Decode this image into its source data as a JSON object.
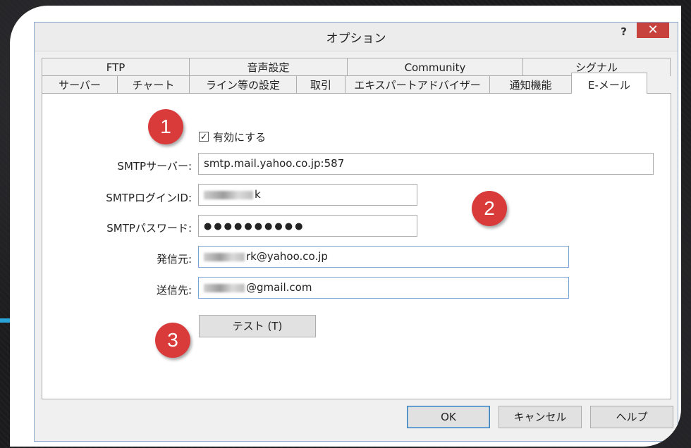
{
  "window": {
    "title": "オプション",
    "help": "?",
    "close": "✕"
  },
  "tabs_row1": [
    "FTP",
    "音声設定",
    "Community",
    "シグナル"
  ],
  "tabs_row2": [
    "サーバー",
    "チャート",
    "ライン等の設定",
    "取引",
    "エキスパートアドバイザー",
    "通知機能",
    "E-メール"
  ],
  "active_tab": "E-メール",
  "form": {
    "enable_label": "有効にする",
    "enable_checked": true,
    "smtp_server_label": "SMTPサーバー:",
    "smtp_server_value": "smtp.mail.yahoo.co.jp:587",
    "smtp_login_label": "SMTPログインID:",
    "smtp_login_value_visible": "k",
    "smtp_password_label": "SMTPパスワード:",
    "smtp_password_value": "●●●●●●●●●●",
    "from_label": "発信元:",
    "from_value_visible": "rk@yahoo.co.jp",
    "to_label": "送信先:",
    "to_value_visible": "@gmail.com",
    "test_button": "テスト (T)"
  },
  "badges": [
    "1",
    "2",
    "3"
  ],
  "footer": {
    "ok": "OK",
    "cancel": "キャンセル",
    "help": "ヘルプ"
  },
  "colors": {
    "badge": "#d93a3a",
    "close": "#c7413d",
    "accent_border": "#7aa3d6"
  }
}
